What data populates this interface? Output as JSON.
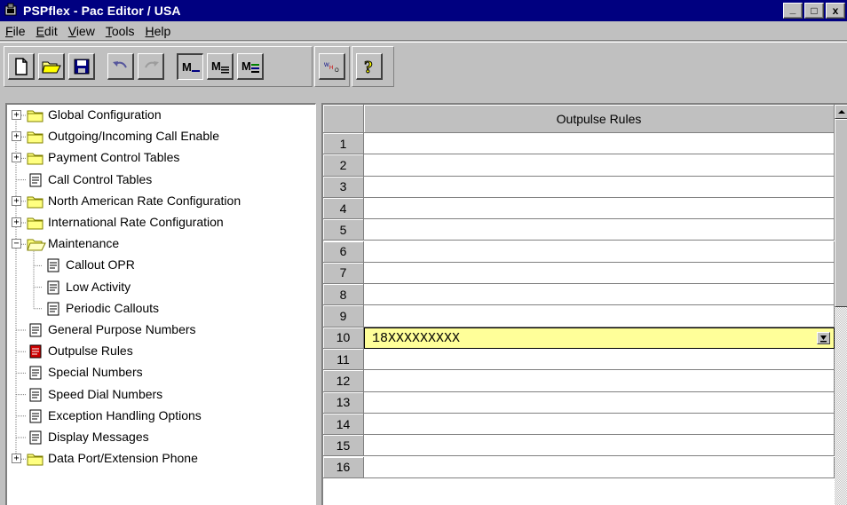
{
  "window": {
    "title": "PSPflex - Pac Editor / USA",
    "controls": {
      "minimize": "_",
      "maximize": "□",
      "close": "x"
    }
  },
  "menu": {
    "items": [
      {
        "label": "File",
        "mnemonic": "F"
      },
      {
        "label": "Edit",
        "mnemonic": "E"
      },
      {
        "label": "View",
        "mnemonic": "V"
      },
      {
        "label": "Tools",
        "mnemonic": "T"
      },
      {
        "label": "Help",
        "mnemonic": "H"
      }
    ]
  },
  "toolbar": {
    "buttons": [
      {
        "icon": "new-document-icon"
      },
      {
        "icon": "open-folder-icon"
      },
      {
        "icon": "save-icon"
      },
      {
        "icon": "undo-icon",
        "disabled": true
      },
      {
        "icon": "redo-icon",
        "disabled": true
      },
      {
        "icon": "m-view-1-icon",
        "text": "M"
      },
      {
        "icon": "m-view-2-icon",
        "text": "M"
      },
      {
        "icon": "m-view-3-icon",
        "text": "M"
      },
      {
        "icon": "who-icon",
        "text": "WHO"
      },
      {
        "icon": "help-icon",
        "text": "?"
      }
    ]
  },
  "tree": {
    "items": [
      {
        "label": "Global Configuration",
        "type": "folder",
        "expander": "+"
      },
      {
        "label": "Outgoing/Incoming Call Enable",
        "type": "folder",
        "expander": "+"
      },
      {
        "label": "Payment Control Tables",
        "type": "folder",
        "expander": "+"
      },
      {
        "label": "Call Control Tables",
        "type": "doc"
      },
      {
        "label": "North American Rate Configuration",
        "type": "folder",
        "expander": "+"
      },
      {
        "label": "International Rate Configuration",
        "type": "folder",
        "expander": "+"
      },
      {
        "label": "Maintenance",
        "type": "folder-open",
        "expander": "−"
      },
      {
        "label": "Callout OPR",
        "type": "doc",
        "child": true
      },
      {
        "label": "Low Activity",
        "type": "doc",
        "child": true
      },
      {
        "label": "Periodic Callouts",
        "type": "doc",
        "child": true
      },
      {
        "label": "General Purpose Numbers",
        "type": "doc"
      },
      {
        "label": "Outpulse Rules",
        "type": "doc",
        "selected": true
      },
      {
        "label": "Special Numbers",
        "type": "doc"
      },
      {
        "label": "Speed Dial Numbers",
        "type": "doc"
      },
      {
        "label": "Exception Handling Options",
        "type": "doc"
      },
      {
        "label": "Display Messages",
        "type": "doc"
      },
      {
        "label": "Data Port/Extension Phone",
        "type": "folder",
        "expander": "+"
      }
    ]
  },
  "grid": {
    "column_header": "Outpulse Rules",
    "rows": [
      {
        "num": "1",
        "value": ""
      },
      {
        "num": "2",
        "value": ""
      },
      {
        "num": "3",
        "value": ""
      },
      {
        "num": "4",
        "value": ""
      },
      {
        "num": "5",
        "value": ""
      },
      {
        "num": "6",
        "value": ""
      },
      {
        "num": "7",
        "value": ""
      },
      {
        "num": "8",
        "value": ""
      },
      {
        "num": "9",
        "value": ""
      },
      {
        "num": "10",
        "value": "18XXXXXXXXX",
        "active": true
      },
      {
        "num": "11",
        "value": ""
      },
      {
        "num": "12",
        "value": ""
      },
      {
        "num": "13",
        "value": ""
      },
      {
        "num": "14",
        "value": ""
      },
      {
        "num": "15",
        "value": ""
      },
      {
        "num": "16",
        "value": ""
      }
    ]
  },
  "colors": {
    "titlebar": "#000080",
    "active_cell": "#ffff99",
    "selected_icon": "#cc0000",
    "folder": "#ffff80"
  }
}
